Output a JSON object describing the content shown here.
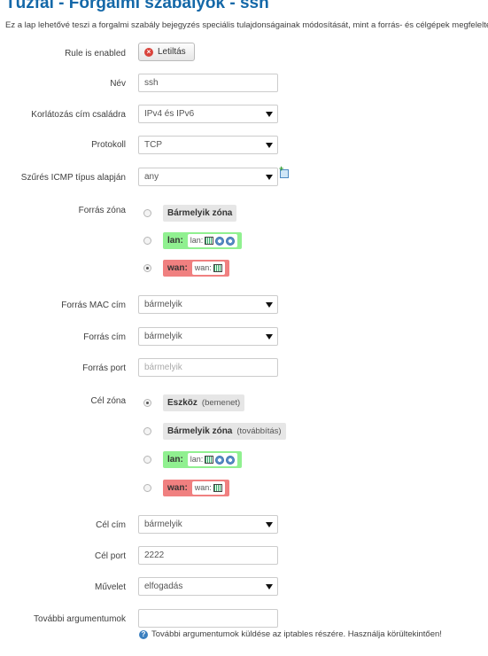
{
  "page": {
    "title": "Tűzfal - Forgalmi szabályok - ssh",
    "description": "Ez a lap lehetővé teszi a forgalmi szabály bejegyzés speciális tulajdonságainak módosítását, mint a forrás- és célgépek megfelelte"
  },
  "fields": {
    "enabled": {
      "label": "Rule is enabled",
      "button": "Letiltás"
    },
    "name": {
      "label": "Név",
      "value": "ssh"
    },
    "family": {
      "label": "Korlátozás cím családra",
      "value": "IPv4 és IPv6"
    },
    "protocol": {
      "label": "Protokoll",
      "value": "TCP"
    },
    "icmp": {
      "label": "Szűrés ICMP típus alapján",
      "value": "any"
    },
    "src_zone": {
      "label": "Forrás zóna"
    },
    "src_mac": {
      "label": "Forrás MAC cím",
      "value": "bármelyik"
    },
    "src_ip": {
      "label": "Forrás cím",
      "value": "bármelyik"
    },
    "src_port": {
      "label": "Forrás port",
      "placeholder": "bármelyik"
    },
    "dest_zone": {
      "label": "Cél zóna"
    },
    "dest_ip": {
      "label": "Cél cím",
      "value": "bármelyik"
    },
    "dest_port": {
      "label": "Cél port",
      "value": "2222"
    },
    "action": {
      "label": "Művelet",
      "value": "elfogadás"
    },
    "extra": {
      "label": "További argumentumok",
      "value": "",
      "help": "További argumentumok küldése az iptables részére. Használja körültekintően!"
    }
  },
  "src_zones": {
    "any": {
      "name": "Bármelyik zóna",
      "selected": false
    },
    "lan": {
      "name": "lan:",
      "iface": "lan:",
      "selected": false
    },
    "wan": {
      "name": "wan:",
      "iface": "wan:",
      "selected": true
    }
  },
  "dest_zones": {
    "device": {
      "name": "Eszköz",
      "sub": "(bemenet)",
      "selected": true
    },
    "any": {
      "name": "Bármelyik zóna",
      "sub": "(továbbítás)",
      "selected": false
    },
    "lan": {
      "name": "lan:",
      "iface": "lan:",
      "selected": false
    },
    "wan": {
      "name": "wan:",
      "iface": "wan:",
      "selected": false
    }
  },
  "colors": {
    "title": "#1468a8",
    "lan_zone": "#90f090",
    "wan_zone": "#f08080",
    "neutral_zone": "#e6e6e6"
  },
  "icons": [
    "disable-icon",
    "add-icon",
    "ethernet-icon",
    "wireless-icon",
    "help-icon"
  ]
}
